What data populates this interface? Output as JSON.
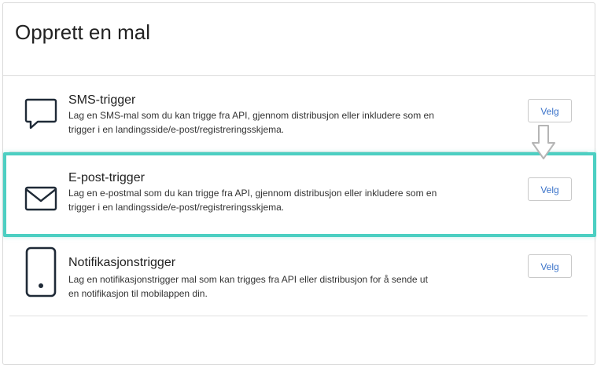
{
  "dialog": {
    "title": "Opprett en mal"
  },
  "templates": [
    {
      "icon": "sms-bubble-icon",
      "title": "SMS-trigger",
      "description": "Lag en SMS-mal som du kan trigge fra API, gjennom distribusjon eller inkludere som en trigger i en landingsside/e-post/registreringsskjema.",
      "button": "Velg"
    },
    {
      "icon": "envelope-icon",
      "title": "E-post-trigger",
      "description": "Lag en e-postmal som du kan trigge fra API, gjennom distribusjon eller inkludere som en trigger i en landingsside/e-post/registreringsskjema.",
      "button": "Velg"
    },
    {
      "icon": "mobile-phone-icon",
      "title": "Notifikasjonstrigger",
      "description": "Lag en notifikasjonstrigger mal som kan trigges fra API eller distribusjon for å sende ut en notifikasjon til mobilappen din.",
      "button": "Velg"
    }
  ],
  "colors": {
    "highlight": "#4ccfc2",
    "button_text": "#3b73c9"
  }
}
